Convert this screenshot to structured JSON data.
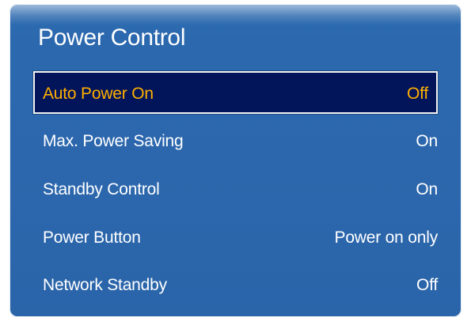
{
  "panel": {
    "title": "Power Control"
  },
  "items": [
    {
      "label": "Auto Power On",
      "value": "Off"
    },
    {
      "label": "Max. Power Saving",
      "value": "On"
    },
    {
      "label": "Standby Control",
      "value": "On"
    },
    {
      "label": "Power Button",
      "value": "Power on only"
    },
    {
      "label": "Network Standby",
      "value": "Off"
    }
  ],
  "selected_index": 0,
  "colors": {
    "panel_blue": "#2c67ad",
    "selected_bg": "#02145a",
    "selected_text": "#ffb000",
    "text": "#ffffff"
  }
}
